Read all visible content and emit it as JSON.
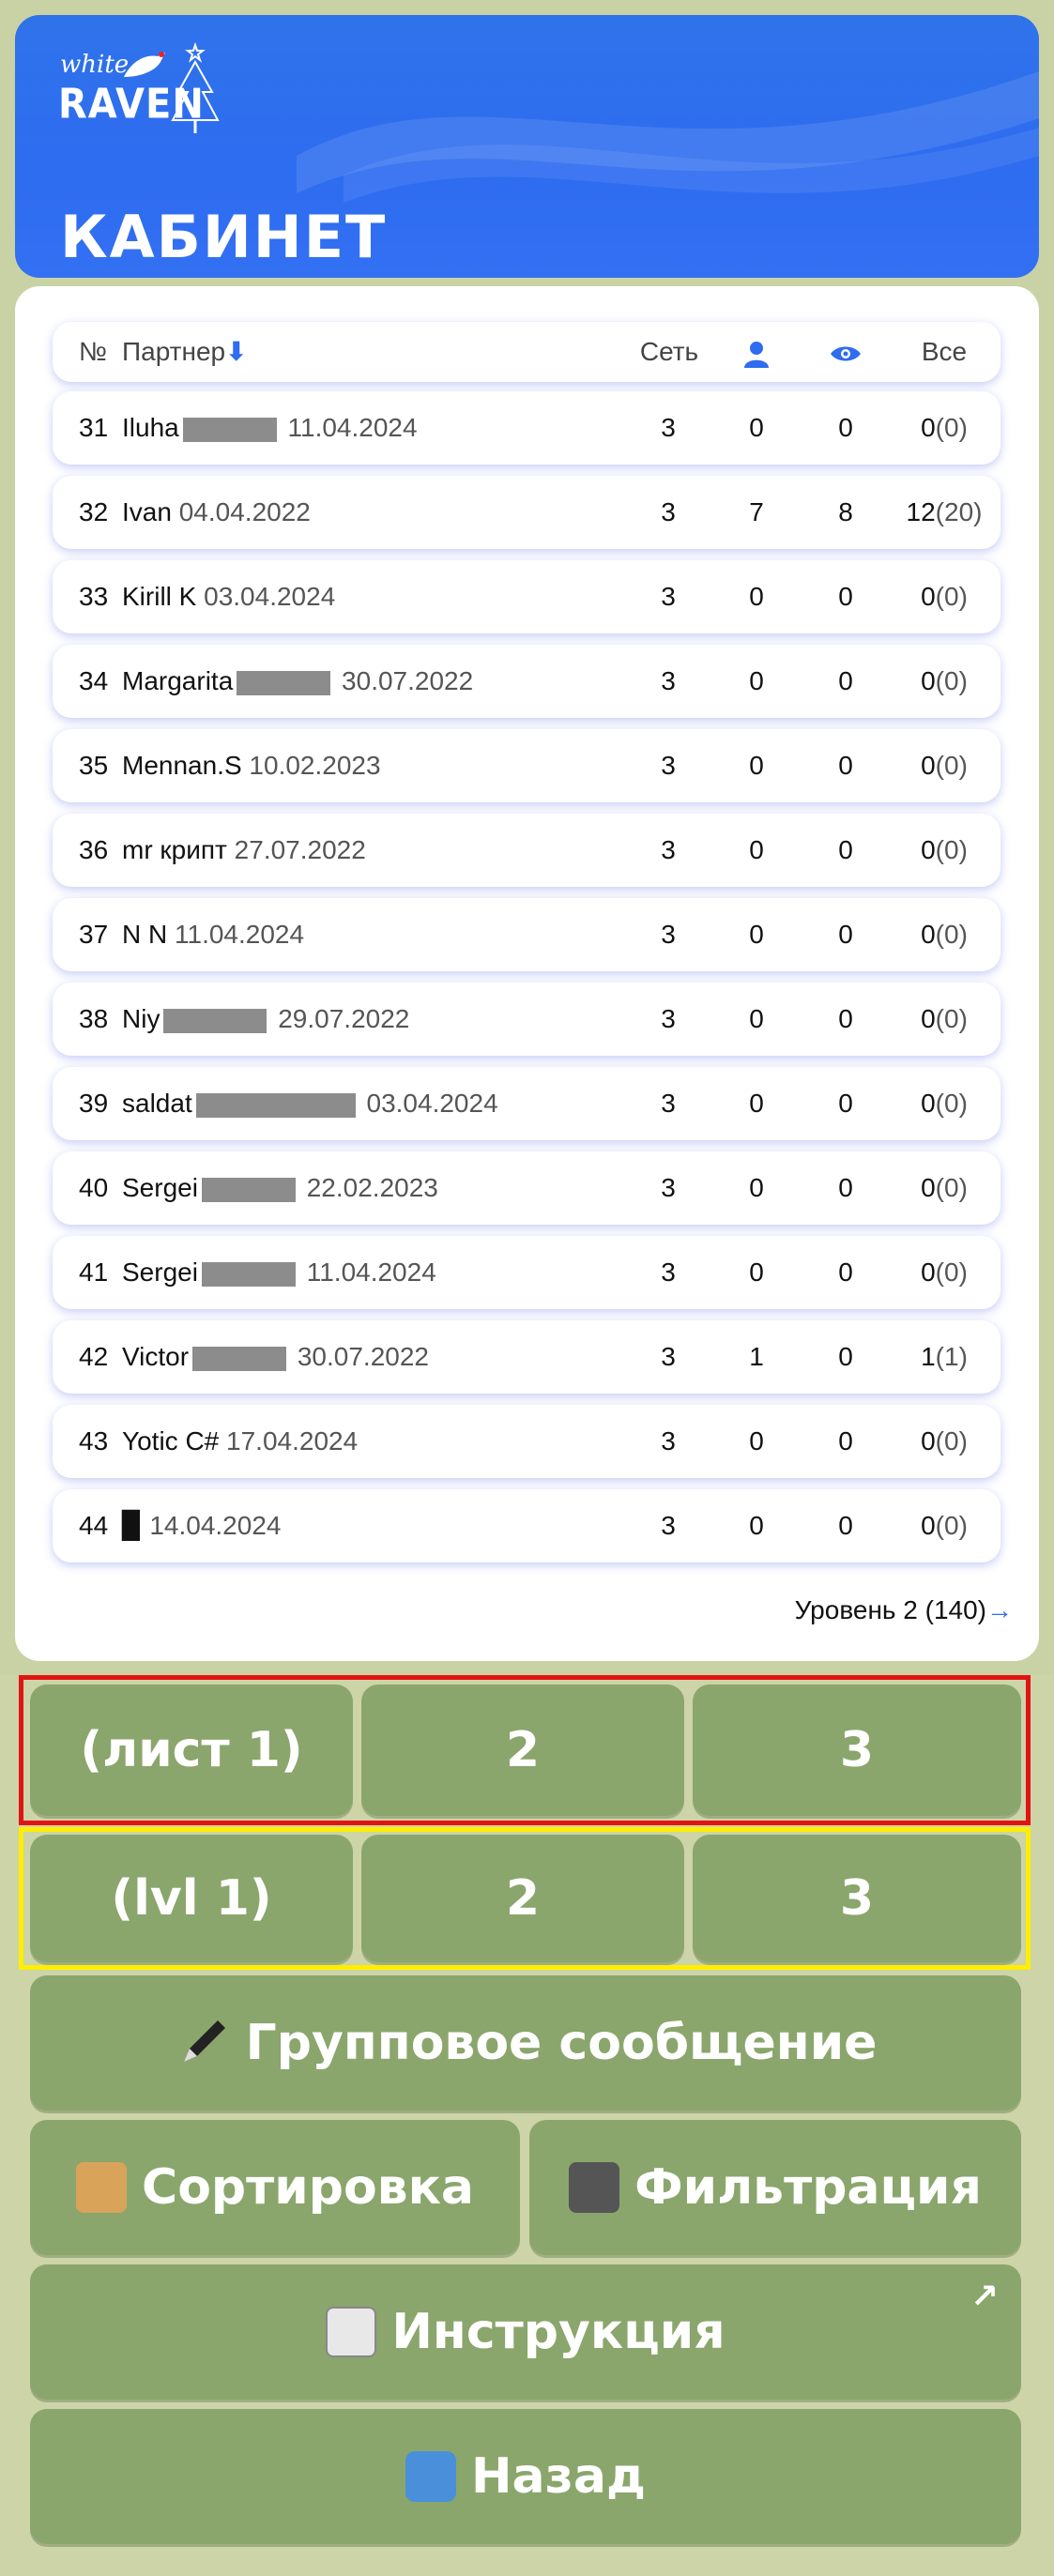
{
  "header": {
    "logo_top": "white",
    "logo_bottom": "RAVEN",
    "title": "КАБИНЕТ"
  },
  "table": {
    "columns": {
      "num": "№",
      "partner": "Партнер",
      "sort_arrow": "⬇",
      "net": "Сеть",
      "all": "Все"
    },
    "column_icons": [
      "person-icon",
      "eye-icon"
    ],
    "rows": [
      {
        "num": "31",
        "name": "Iluha",
        "date": "11.04.2024",
        "net": "3",
        "c2": "0",
        "c3": "0",
        "all": "0",
        "paren": "(0)"
      },
      {
        "num": "32",
        "name": "Ivan",
        "date": "04.04.2022",
        "net": "3",
        "c2": "7",
        "c3": "8",
        "all": "12",
        "paren": "(20)"
      },
      {
        "num": "33",
        "name": "Kirill K",
        "date": "03.04.2024",
        "net": "3",
        "c2": "0",
        "c3": "0",
        "all": "0",
        "paren": "(0)"
      },
      {
        "num": "34",
        "name": "Margarita",
        "date": "30.07.2022",
        "net": "3",
        "c2": "0",
        "c3": "0",
        "all": "0",
        "paren": "(0)"
      },
      {
        "num": "35",
        "name": "Mennan.S",
        "date": "10.02.2023",
        "net": "3",
        "c2": "0",
        "c3": "0",
        "all": "0",
        "paren": "(0)"
      },
      {
        "num": "36",
        "name": "mr крипт",
        "date": "27.07.2022",
        "net": "3",
        "c2": "0",
        "c3": "0",
        "all": "0",
        "paren": "(0)"
      },
      {
        "num": "37",
        "name": "N N",
        "date": "11.04.2024",
        "net": "3",
        "c2": "0",
        "c3": "0",
        "all": "0",
        "paren": "(0)"
      },
      {
        "num": "38",
        "name": "Niy",
        "date": "29.07.2022",
        "net": "3",
        "c2": "0",
        "c3": "0",
        "all": "0",
        "paren": "(0)"
      },
      {
        "num": "39",
        "name": "saldat",
        "date": "03.04.2024",
        "net": "3",
        "c2": "0",
        "c3": "0",
        "all": "0",
        "paren": "(0)"
      },
      {
        "num": "40",
        "name": "Sergei",
        "date": "22.02.2023",
        "net": "3",
        "c2": "0",
        "c3": "0",
        "all": "0",
        "paren": "(0)"
      },
      {
        "num": "41",
        "name": "Sergei",
        "date": "11.04.2024",
        "net": "3",
        "c2": "0",
        "c3": "0",
        "all": "0",
        "paren": "(0)"
      },
      {
        "num": "42",
        "name": "Victor",
        "date": "30.07.2022",
        "net": "3",
        "c2": "1",
        "c3": "0",
        "all": "1",
        "paren": "(1)"
      },
      {
        "num": "43",
        "name": "Yotic C#",
        "date": "17.04.2024",
        "net": "3",
        "c2": "0",
        "c3": "0",
        "all": "0",
        "paren": "(0)"
      },
      {
        "num": "44",
        "name": "▉",
        "date": "14.04.2024",
        "net": "3",
        "c2": "0",
        "c3": "0",
        "all": "0",
        "paren": "(0)"
      }
    ],
    "level_link": "Уровень 2 (140)",
    "level_arrow": "→"
  },
  "keyboard": {
    "row1": [
      "(лист 1)",
      "2",
      "3"
    ],
    "row2": [
      "(lvl 1)",
      "2",
      "3"
    ],
    "group_message": "Групповое сообщение",
    "sort": "Сортировка",
    "filter": "Фильтрация",
    "instruction": "Инструкция",
    "back": "Назад",
    "external_arrow": "↗"
  },
  "colors": {
    "header_blue": "#2e6cf0",
    "button_green": "#8aa66c",
    "highlight_red": "#e11414",
    "highlight_yellow": "#ffee00"
  }
}
